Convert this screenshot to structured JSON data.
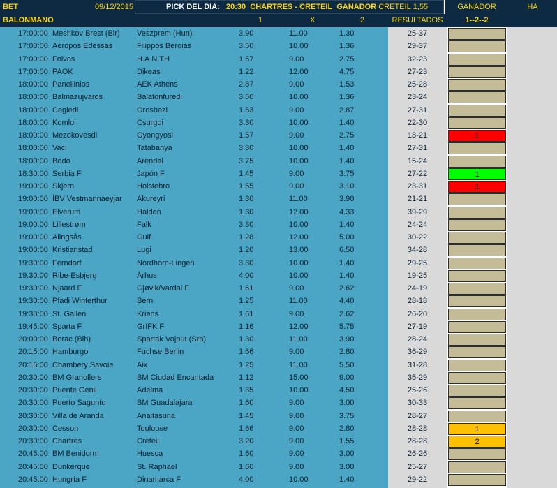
{
  "header": {
    "bet_label": "BET",
    "date": "09/12/2015",
    "pick_label": "PICK DEL DIA:",
    "pick_time": "20:30",
    "pick_match": "CHARTRES - CRETEIL",
    "pick_winner_label": "GANADOR",
    "pick_winner": "CRETEIL",
    "pick_odds": "1,55",
    "ganador_label": "GANADOR",
    "ha_label": "HA"
  },
  "subheader": {
    "sport": "BALONMANO",
    "col1": "1",
    "colx": "X",
    "col2": "2",
    "results": "RESULTADOS",
    "code": "1--2--2"
  },
  "colors": {
    "panel_blue": "#4aa6c4",
    "header_navy": "#0e2a42",
    "header_text": "#ffd400",
    "results_gray": "#d9d9d9",
    "code_khaki": "#c4bc96",
    "red": "#ff0000",
    "green": "#00ff00",
    "gold": "#ffc000"
  },
  "rows": [
    {
      "time": "17:00:00",
      "home": "Meshkov Brest (Blr)",
      "away": "Veszprem (Hun)",
      "o1": "3.90",
      "ox": "11.00",
      "o2": "1.30",
      "res": "25-37",
      "code": "",
      "color": ""
    },
    {
      "time": "17:00:00",
      "home": "Aeropos Edessas",
      "away": "Filippos Beroias",
      "o1": "3.50",
      "ox": "10.00",
      "o2": "1.36",
      "res": "29-37",
      "code": "",
      "color": ""
    },
    {
      "time": "17:00:00",
      "home": "Foivos",
      "away": "H.A.N.TH",
      "o1": "1.57",
      "ox": "9.00",
      "o2": "2.75",
      "res": "32-23",
      "code": "",
      "color": ""
    },
    {
      "time": "17:00:00",
      "home": "PAOK",
      "away": "Dikeas",
      "o1": "1.22",
      "ox": "12.00",
      "o2": "4.75",
      "res": "27-23",
      "code": "",
      "color": ""
    },
    {
      "time": "18:00:00",
      "home": "Panellinios",
      "away": "AEK Athens",
      "o1": "2.87",
      "ox": "9.00",
      "o2": "1.53",
      "res": "25-28",
      "code": "",
      "color": ""
    },
    {
      "time": "18:00:00",
      "home": "Balmazujvaros",
      "away": "Balatonfuredi",
      "o1": "3.50",
      "ox": "10.00",
      "o2": "1.36",
      "res": "23-24",
      "code": "",
      "color": ""
    },
    {
      "time": "18:00:00",
      "home": "Cegledi",
      "away": "Oroshazi",
      "o1": "1.53",
      "ox": "9.00",
      "o2": "2.87",
      "res": "27-31",
      "code": "",
      "color": ""
    },
    {
      "time": "18:00:00",
      "home": "Komloi",
      "away": "Csurgoi",
      "o1": "3.30",
      "ox": "10.00",
      "o2": "1.40",
      "res": "22-30",
      "code": "",
      "color": ""
    },
    {
      "time": "18:00:00",
      "home": "Mezokovesdi",
      "away": "Gyongyosi",
      "o1": "1.57",
      "ox": "9.00",
      "o2": "2.75",
      "res": "18-21",
      "code": "1",
      "color": "red"
    },
    {
      "time": "18:00:00",
      "home": "Vaci",
      "away": "Tatabanya",
      "o1": "3.30",
      "ox": "10.00",
      "o2": "1.40",
      "res": "27-31",
      "code": "",
      "color": ""
    },
    {
      "time": "18:00:00",
      "home": "Bodo",
      "away": "Arendal",
      "o1": "3.75",
      "ox": "10.00",
      "o2": "1.40",
      "res": "15-24",
      "code": "",
      "color": ""
    },
    {
      "time": "18:30:00",
      "home": "Serbia F",
      "away": "Japón F",
      "o1": "1.45",
      "ox": "9.00",
      "o2": "3.75",
      "res": "27-22",
      "code": "1",
      "color": "green"
    },
    {
      "time": "19:00:00",
      "home": "Skjern",
      "away": "Holstebro",
      "o1": "1.55",
      "ox": "9.00",
      "o2": "3.10",
      "res": "23-31",
      "code": "1",
      "color": "red"
    },
    {
      "time": "19:00:00",
      "home": "ÍBV Vestmannaeyjar",
      "away": "Akureyri",
      "o1": "1.30",
      "ox": "11.00",
      "o2": "3.90",
      "res": "21-21",
      "code": "",
      "color": ""
    },
    {
      "time": "19:00:00",
      "home": "Elverum",
      "away": "Halden",
      "o1": "1.30",
      "ox": "12.00",
      "o2": "4.33",
      "res": "39-29",
      "code": "",
      "color": ""
    },
    {
      "time": "19:00:00",
      "home": "Lillestrøm",
      "away": "Falk",
      "o1": "3.30",
      "ox": "10.00",
      "o2": "1.40",
      "res": "24-24",
      "code": "",
      "color": ""
    },
    {
      "time": "19:00:00",
      "home": "Alingsås",
      "away": "Guif",
      "o1": "1.28",
      "ox": "12.00",
      "o2": "5.00",
      "res": "30-22",
      "code": "",
      "color": ""
    },
    {
      "time": "19:00:00",
      "home": "Kristianstad",
      "away": "Lugi",
      "o1": "1.20",
      "ox": "13.00",
      "o2": "6.50",
      "res": "34-28",
      "code": "",
      "color": ""
    },
    {
      "time": "19:30:00",
      "home": "Ferndorf",
      "away": "Nordhorn-Lingen",
      "o1": "3.30",
      "ox": "10.00",
      "o2": "1.40",
      "res": "29-25",
      "code": "",
      "color": ""
    },
    {
      "time": "19:30:00",
      "home": "Ribe-Esbjerg",
      "away": "Århus",
      "o1": "4.00",
      "ox": "10.00",
      "o2": "1.40",
      "res": "19-25",
      "code": "",
      "color": ""
    },
    {
      "time": "19:30:00",
      "home": "Njaard F",
      "away": "Gjøvik/Vardal F",
      "o1": "1.61",
      "ox": "9.00",
      "o2": "2.62",
      "res": "24-19",
      "code": "",
      "color": ""
    },
    {
      "time": "19:30:00",
      "home": "Pfadi Winterthur",
      "away": "Bern",
      "o1": "1.25",
      "ox": "11.00",
      "o2": "4.40",
      "res": "28-18",
      "code": "",
      "color": ""
    },
    {
      "time": "19:30:00",
      "home": "St. Gallen",
      "away": "Kriens",
      "o1": "1.61",
      "ox": "9.00",
      "o2": "2.62",
      "res": "26-20",
      "code": "",
      "color": ""
    },
    {
      "time": "19:45:00",
      "home": "Sparta F",
      "away": "GrIFK F",
      "o1": "1.16",
      "ox": "12.00",
      "o2": "5.75",
      "res": "27-19",
      "code": "",
      "color": ""
    },
    {
      "time": "20:00:00",
      "home": "Borac (Bih)",
      "away": "Spartak Vojput (Srb)",
      "o1": "1.30",
      "ox": "11.00",
      "o2": "3.90",
      "res": "28-24",
      "code": "",
      "color": ""
    },
    {
      "time": "20:15:00",
      "home": "Hamburgo",
      "away": "Fuchse Berlin",
      "o1": "1.66",
      "ox": "9.00",
      "o2": "2.80",
      "res": "36-29",
      "code": "",
      "color": ""
    },
    {
      "time": "20:15:00",
      "home": "Chambery Savoie",
      "away": "Aix",
      "o1": "1.25",
      "ox": "11.00",
      "o2": "5.50",
      "res": "31-28",
      "code": "",
      "color": ""
    },
    {
      "time": "20:30:00",
      "home": "BM Granollers",
      "away": "BM Ciudad Encantada",
      "o1": "1.12",
      "ox": "15.00",
      "o2": "9.00",
      "res": "35-29",
      "code": "",
      "color": ""
    },
    {
      "time": "20:30:00",
      "home": "Puente Genil",
      "away": "Adelma",
      "o1": "1.35",
      "ox": "10.00",
      "o2": "4.50",
      "res": "25-26",
      "code": "",
      "color": ""
    },
    {
      "time": "20:30:00",
      "home": "Puerto Sagunto",
      "away": "BM Guadalajara",
      "o1": "1.60",
      "ox": "9.00",
      "o2": "3.00",
      "res": "30-33",
      "code": "",
      "color": ""
    },
    {
      "time": "20:30:00",
      "home": "Villa de Aranda",
      "away": "Anaitasuna",
      "o1": "1.45",
      "ox": "9.00",
      "o2": "3.75",
      "res": "28-27",
      "code": "",
      "color": ""
    },
    {
      "time": "20:30:00",
      "home": "Cesson",
      "away": "Toulouse",
      "o1": "1.66",
      "ox": "9.00",
      "o2": "2.80",
      "res": "28-28",
      "code": "1",
      "color": "gold"
    },
    {
      "time": "20:30:00",
      "home": "Chartres",
      "away": "Creteil",
      "o1": "3.20",
      "ox": "9.00",
      "o2": "1.55",
      "res": "28-28",
      "code": "2",
      "color": "gold"
    },
    {
      "time": "20:45:00",
      "home": "BM Benidorm",
      "away": "Huesca",
      "o1": "1.60",
      "ox": "9.00",
      "o2": "3.00",
      "res": "26-26",
      "code": "",
      "color": ""
    },
    {
      "time": "20:45:00",
      "home": "Dunkerque",
      "away": "St. Raphael",
      "o1": "1.60",
      "ox": "9.00",
      "o2": "3.00",
      "res": "25-27",
      "code": "",
      "color": ""
    },
    {
      "time": "20:45:00",
      "home": "Hungría F",
      "away": "Dinamarca F",
      "o1": "4.00",
      "ox": "10.00",
      "o2": "1.40",
      "res": "29-22",
      "code": "",
      "color": ""
    }
  ]
}
